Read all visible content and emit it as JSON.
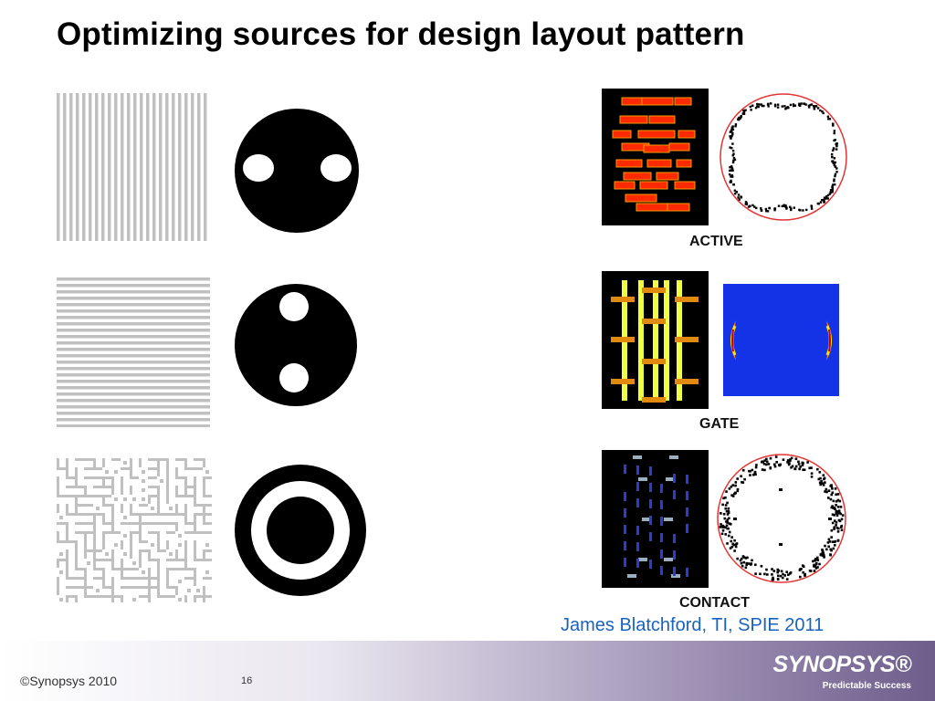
{
  "slide": {
    "title": "Optimizing sources for design layout pattern",
    "credit": "James Blatchford, TI, SPIE 2011"
  },
  "panels": [
    {
      "label": "ACTIVE"
    },
    {
      "label": "GATE"
    },
    {
      "label": "CONTACT"
    }
  ],
  "footer": {
    "copyright": "©Synopsys 2010",
    "page_number": "16",
    "logo_text": "SYNOPSYS®",
    "tagline": "Predictable Success"
  },
  "colors": {
    "credit": "#1a62c0",
    "pattern_gray": "#c0c0c0",
    "footer_purple": "#6d5d8b"
  }
}
